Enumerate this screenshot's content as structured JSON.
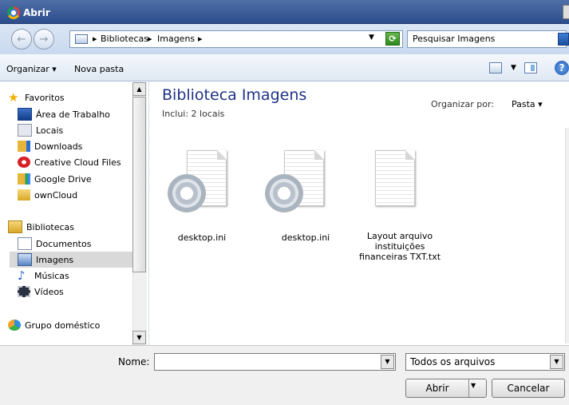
{
  "window": {
    "title": "Abrir"
  },
  "address": {
    "crumbs": [
      "Bibliotecas",
      "Imagens"
    ],
    "sep": "▸"
  },
  "search": {
    "placeholder": "Pesquisar Imagens"
  },
  "toolbar": {
    "organize": "Organizar ▾",
    "new_folder": "Nova pasta",
    "help": "?"
  },
  "nav": {
    "favorites_header": "Favoritos",
    "favorites": [
      {
        "label": "Área de Trabalho",
        "icon": "desktop-icon"
      },
      {
        "label": "Locais",
        "icon": "recent-places-icon"
      },
      {
        "label": "Downloads",
        "icon": "downloads-folder-icon"
      },
      {
        "label": "Creative Cloud Files",
        "icon": "creative-cloud-icon"
      },
      {
        "label": "Google Drive",
        "icon": "google-drive-icon"
      },
      {
        "label": "ownCloud",
        "icon": "owncloud-folder-icon"
      }
    ],
    "libraries_header": "Bibliotecas",
    "libraries": [
      {
        "label": "Documentos",
        "icon": "documents-library-icon"
      },
      {
        "label": "Imagens",
        "icon": "pictures-library-icon",
        "selected": true
      },
      {
        "label": "Músicas",
        "icon": "music-library-icon"
      },
      {
        "label": "Vídeos",
        "icon": "videos-library-icon"
      }
    ],
    "homegroup": "Grupo doméstico"
  },
  "content": {
    "title": "Biblioteca Imagens",
    "subtitle": "Inclui:  2 locais",
    "arrange_label": "Organizar por:",
    "arrange_value": "Pasta  ▾",
    "files": [
      {
        "name": "desktop.ini",
        "type": "settings"
      },
      {
        "name": "desktop.ini",
        "type": "settings"
      },
      {
        "name": [
          "Layout arquivo",
          "instituições",
          "financeiras TXT.txt"
        ],
        "type": "text"
      }
    ]
  },
  "footer": {
    "name_label": "Nome:",
    "name_value": "",
    "filter": "Todos os arquivos",
    "open": "Abrir",
    "cancel": "Cancelar"
  },
  "colors": {
    "title_bar": "#2b4d8c",
    "library_title": "#1e3287",
    "selection": "#d9d9d9"
  }
}
